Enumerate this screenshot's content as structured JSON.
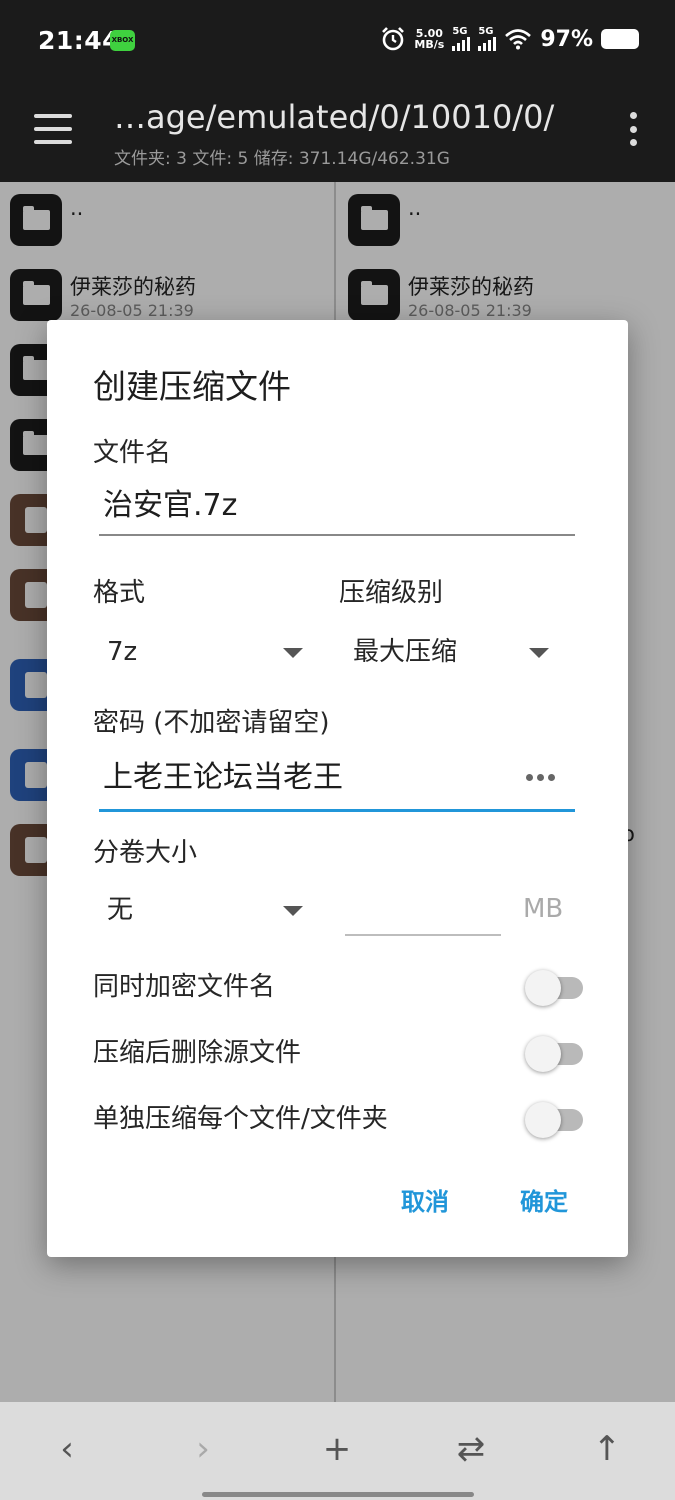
{
  "status_bar": {
    "time": "21:44",
    "app_badge": "XBOX",
    "net_speed_value": "5.00",
    "net_speed_unit": "MB/s",
    "sim1": "5G",
    "sim2": "5G",
    "battery": "97%"
  },
  "app_bar": {
    "path": "…age/emulated/0/10010/0/",
    "stats": "文件夹: 3  文件: 5  储存: 371.14G/462.31G"
  },
  "left_pane": {
    "rows": [
      {
        "name": "..",
        "date": "",
        "type": "folder"
      },
      {
        "name": "伊莱莎的秘药",
        "date": "26-08-05 21:39",
        "type": "folder"
      },
      {
        "name": "",
        "date": "",
        "type": "folder"
      },
      {
        "name": "",
        "date": "",
        "type": "folder"
      },
      {
        "name": "",
        "date": "",
        "type": "archive"
      },
      {
        "name": "",
        "date": "",
        "type": "archive"
      },
      {
        "name": "",
        "date": "",
        "type": "doc"
      },
      {
        "name": "",
        "date": "",
        "type": "doc"
      },
      {
        "name": "",
        "date": "",
        "type": "archive"
      }
    ]
  },
  "right_pane": {
    "rows": [
      {
        "name": "..",
        "date": "",
        "type": "folder"
      },
      {
        "name": "伊莱莎的秘药",
        "date": "26-08-05 21:39",
        "type": "folder"
      }
    ],
    "peek_text": "o"
  },
  "dialog": {
    "title": "创建压缩文件",
    "filename_label": "文件名",
    "filename_value": "治安官.7z",
    "format_label": "格式",
    "format_value": "7z",
    "level_label": "压缩级别",
    "level_value": "最大压缩",
    "password_label": "密码 (不加密请留空)",
    "password_value": "上老王论坛当老王",
    "volume_label": "分卷大小",
    "volume_value": "无",
    "volume_size_value": "",
    "volume_unit": "MB",
    "switches": [
      {
        "label": "同时加密文件名",
        "on": false
      },
      {
        "label": "压缩后删除源文件",
        "on": false
      },
      {
        "label": "单独压缩每个文件/文件夹",
        "on": false
      }
    ],
    "cancel_label": "取消",
    "ok_label": "确定"
  },
  "bottom_bar": {
    "back": "‹",
    "forward": "›",
    "add": "+",
    "swap": "⇄",
    "up": "↑"
  },
  "colors": {
    "accent": "#2196d9",
    "bar_dark": "#1b1b1b",
    "folder_icon": "#1c1c1c",
    "archive_icon": "#6b4a3a",
    "doc_icon": "#2e62b8"
  }
}
